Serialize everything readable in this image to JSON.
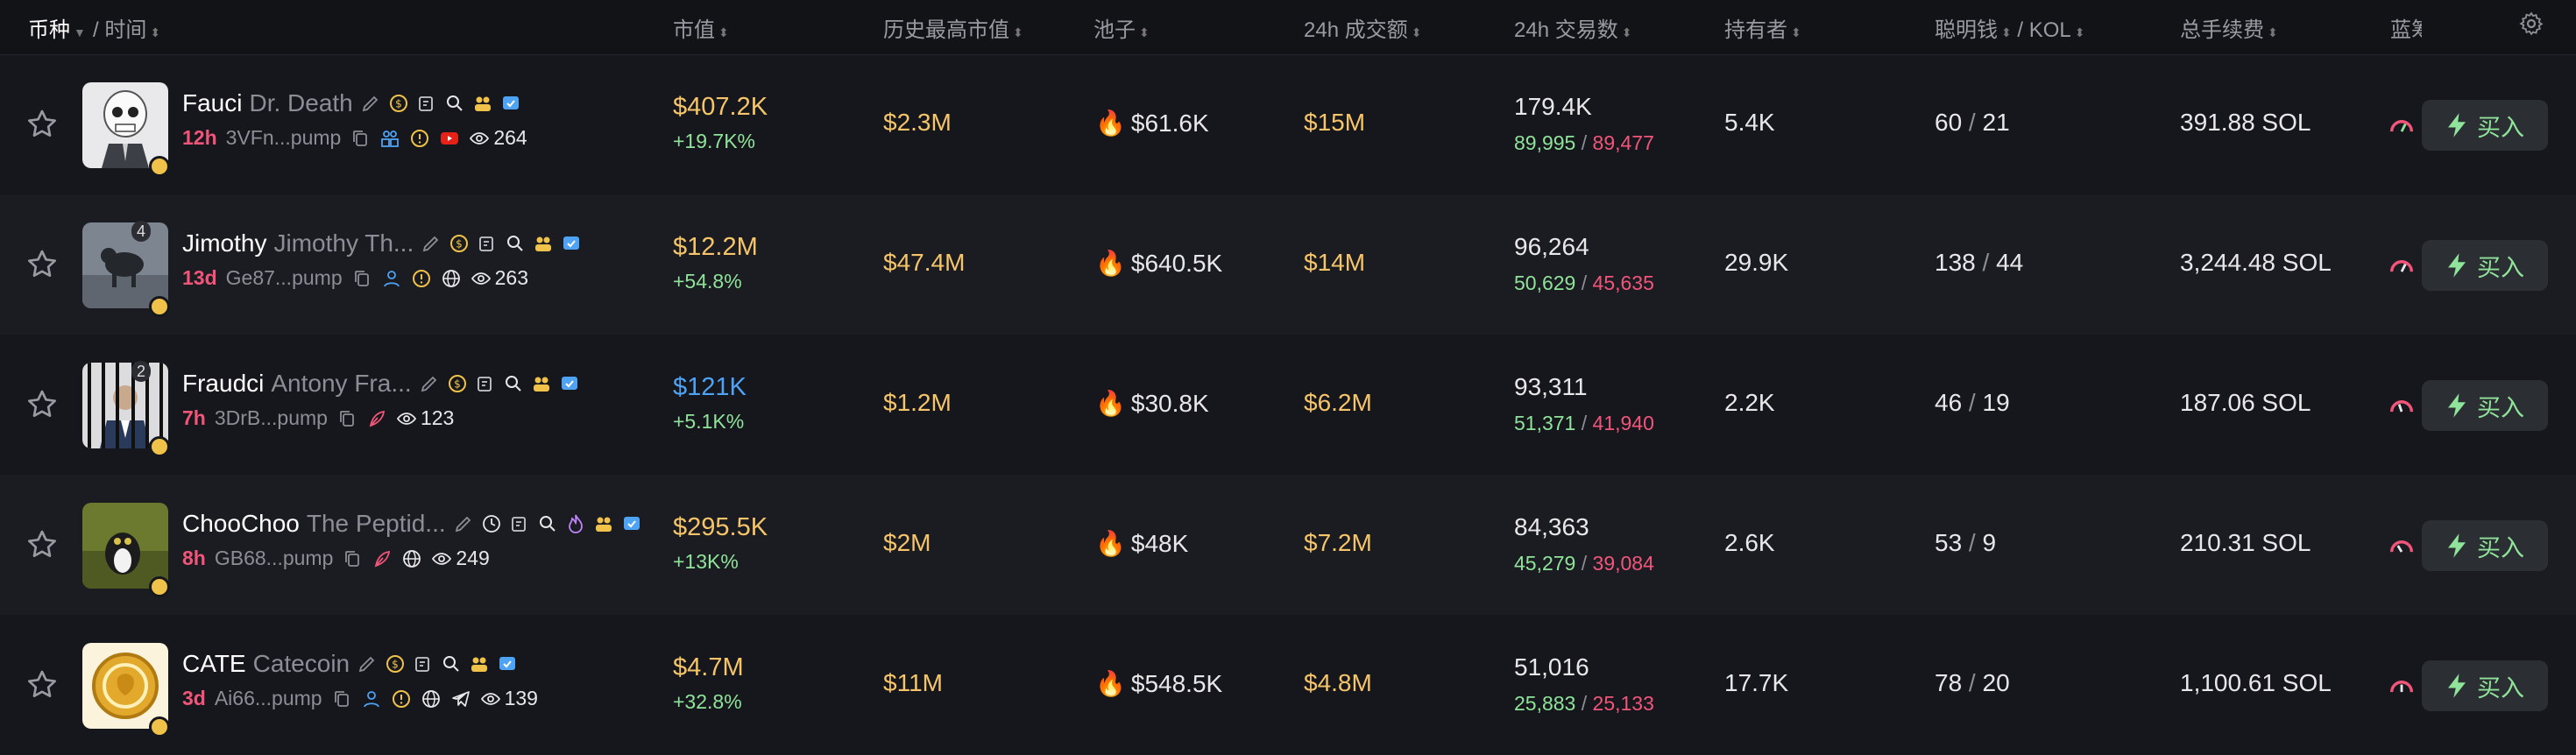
{
  "header": {
    "coin": "币种",
    "time": "时间",
    "mcap": "市值",
    "ath": "历史最高市值",
    "pool": "池子",
    "vol": "24h 成交额",
    "txns": "24h 交易数",
    "holders": "持有者",
    "smart": "聪明钱",
    "kol": "KOL",
    "fees": "总手续费",
    "bluechip": "蓝筹"
  },
  "buy_label": "买入",
  "colors": {
    "accent_green": "#8fe39a",
    "gold": "#f6c56a",
    "red": "#f2557a",
    "blue": "#4ea3f5"
  },
  "rows": [
    {
      "symbol": "Fauci",
      "name": "Dr. Death",
      "age": "12h",
      "address": "3VFn...pump",
      "views": "264",
      "mcap": "$407.2K",
      "mcap_change": "+19.7K%",
      "ath": "$2.3M",
      "pool": "$61.6K",
      "vol": "$15M",
      "txns": "179.4K",
      "buys": "89,995",
      "sells": "89,477",
      "holders": "5.4K",
      "smart": "60",
      "kol": "21",
      "fees": "391.88 SOL",
      "badge": ""
    },
    {
      "symbol": "Jimothy",
      "name": "Jimothy Th...",
      "age": "13d",
      "address": "Ge87...pump",
      "views": "263",
      "mcap": "$12.2M",
      "mcap_change": "+54.8%",
      "ath": "$47.4M",
      "pool": "$640.5K",
      "vol": "$14M",
      "txns": "96,264",
      "buys": "50,629",
      "sells": "45,635",
      "holders": "29.9K",
      "smart": "138",
      "kol": "44",
      "fees": "3,244.48 SOL",
      "badge": "4"
    },
    {
      "symbol": "Fraudci",
      "name": "Antony Fra...",
      "age": "7h",
      "address": "3DrB...pump",
      "views": "123",
      "mcap": "$121K",
      "mcap_change": "+5.1K%",
      "ath": "$1.2M",
      "pool": "$30.8K",
      "vol": "$6.2M",
      "txns": "93,311",
      "buys": "51,371",
      "sells": "41,940",
      "holders": "2.2K",
      "smart": "46",
      "kol": "19",
      "fees": "187.06 SOL",
      "badge": "2"
    },
    {
      "symbol": "ChooChoo",
      "name": "The Peptid...",
      "age": "8h",
      "address": "GB68...pump",
      "views": "249",
      "mcap": "$295.5K",
      "mcap_change": "+13K%",
      "ath": "$2M",
      "pool": "$48K",
      "vol": "$7.2M",
      "txns": "84,363",
      "buys": "45,279",
      "sells": "39,084",
      "holders": "2.6K",
      "smart": "53",
      "kol": "9",
      "fees": "210.31 SOL",
      "badge": ""
    },
    {
      "symbol": "CATE",
      "name": "Catecoin",
      "age": "3d",
      "address": "Ai66...pump",
      "views": "139",
      "mcap": "$4.7M",
      "mcap_change": "+32.8%",
      "ath": "$11M",
      "pool": "$548.5K",
      "vol": "$4.8M",
      "txns": "51,016",
      "buys": "25,883",
      "sells": "25,133",
      "holders": "17.7K",
      "smart": "78",
      "kol": "20",
      "fees": "1,100.61 SOL",
      "badge": ""
    }
  ]
}
